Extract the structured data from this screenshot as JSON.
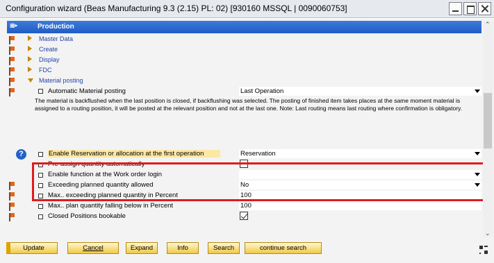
{
  "window": {
    "title": "Configuration wizard (Beas Manufacturing 9.3 (2.15) PL: 02) [930160 MSSQL | 0090060753]"
  },
  "section": {
    "title": "Production"
  },
  "tree": {
    "items": [
      "Master Data",
      "Create",
      "Display",
      "FDC",
      "Material posting"
    ]
  },
  "settings": [
    {
      "label": "Automatic Material posting",
      "value": "Last Operation"
    },
    {
      "label": "Enable Reservation or allocation at the first operation",
      "value": "Reservation"
    },
    {
      "label": "Pre-assign quantity automatically",
      "value": ""
    },
    {
      "label": "Enable function at the Work order login",
      "value": ""
    },
    {
      "label": "Exceeding planned quantity allowed",
      "value": "No"
    },
    {
      "label": "Max.. exceeding planned quantity in Percent",
      "value": "100"
    },
    {
      "label": "Max.. plan quantity falling below in Percent",
      "value": "100"
    },
    {
      "label": "Closed Positions bookable",
      "value": ""
    }
  ],
  "description": "The material is backflushed when the last position is closed, if backflushing was selected. The posting of finished item takes places at the same moment material is assigned to a routing position, it will be posted at the relevant position and not at the last one. Note: Last routing means last routing where confirmation is obligatory.",
  "buttons": {
    "update": "Update",
    "cancel": "Cancel",
    "expand": "Expand",
    "info": "Info",
    "search": "Search",
    "continue_search": "continue search"
  },
  "icons": {
    "flag": "flag-icon",
    "help": "help-icon",
    "expand_tree": "triangle-right-icon",
    "collapse_tree": "triangle-down-icon"
  },
  "colors": {
    "header_blue": "#1f5dc7",
    "highlight": "#fde7a5",
    "red_box": "#e01b1b",
    "button": "#f1c945"
  }
}
